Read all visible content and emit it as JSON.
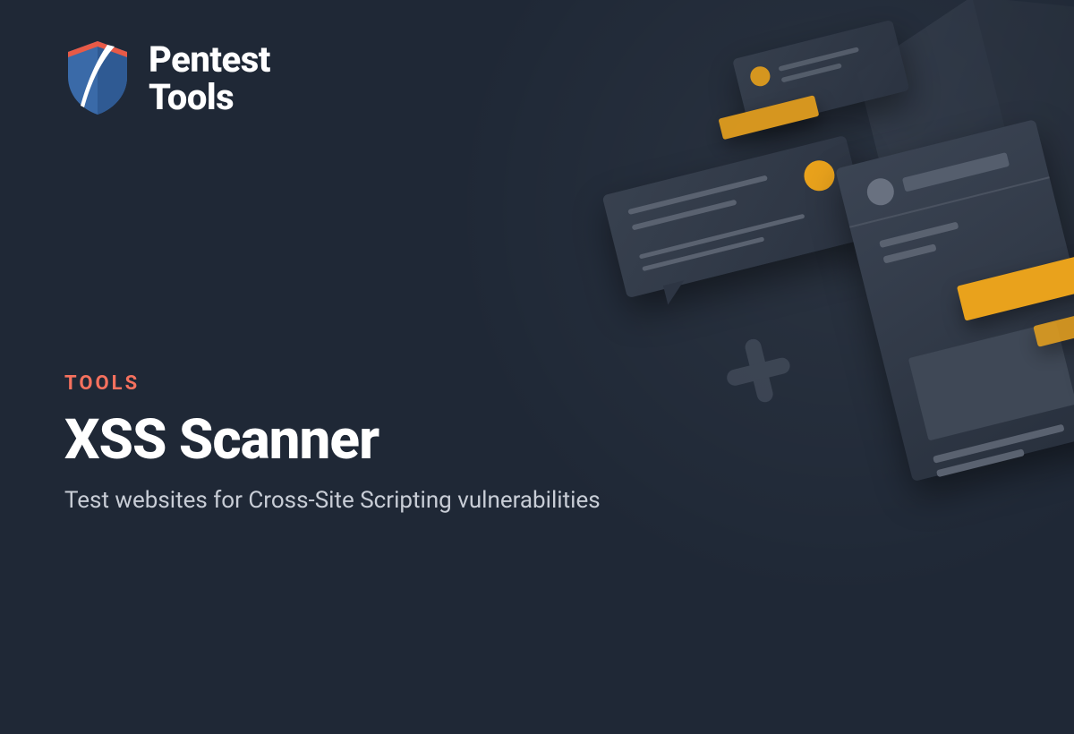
{
  "brand": {
    "line1": "Pentest",
    "line2": "Tools"
  },
  "category": "TOOLS",
  "title": "XSS Scanner",
  "subtitle": "Test websites for Cross-Site Scripting vulnerabilities",
  "colors": {
    "background": "#1f2836",
    "accent_orange": "#e9a21c",
    "accent_coral": "#f5715e",
    "shield_blue": "#3a6aa8"
  }
}
